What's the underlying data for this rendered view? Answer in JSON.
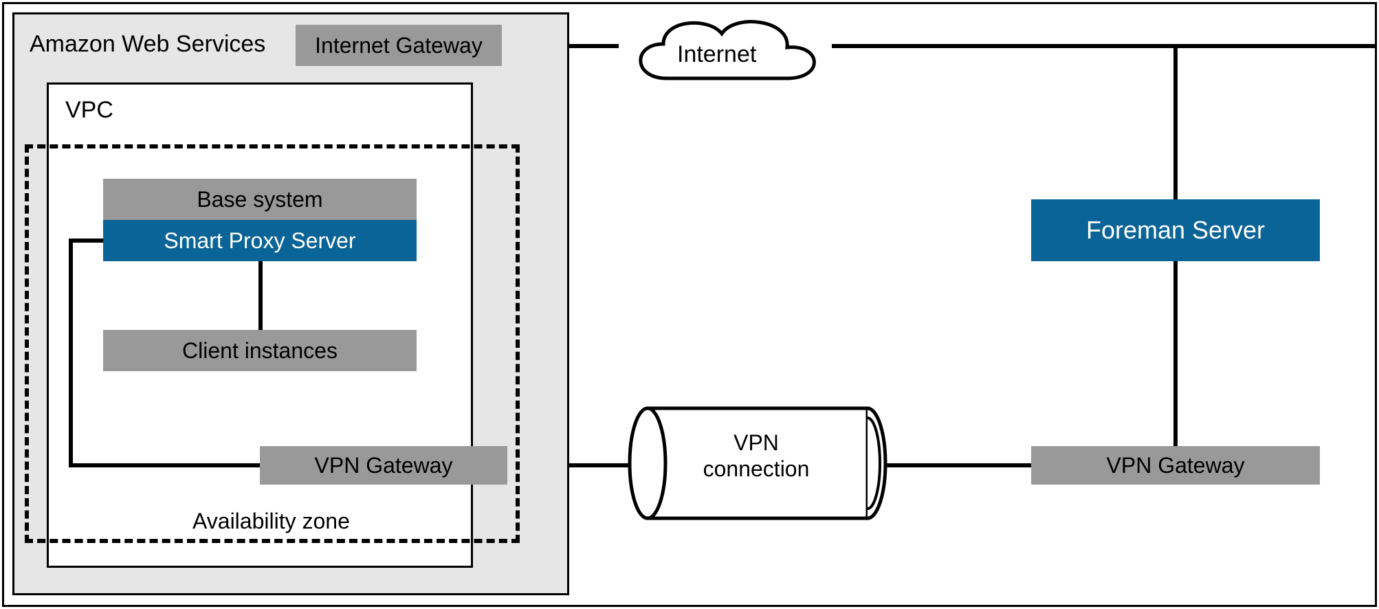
{
  "aws": {
    "title": "Amazon Web Services",
    "internet_gateway_label": "Internet Gateway"
  },
  "vpc": {
    "title": "VPC",
    "availability_zone_label": "Availability zone",
    "base_system_label": "Base system",
    "smart_proxy_label": "Smart Proxy Server",
    "client_instances_label": "Client instances",
    "vpn_gateway_label": "VPN Gateway"
  },
  "internet_label": "Internet",
  "vpn_connection_label": "VPN connection",
  "onprem": {
    "foreman_label": "Foreman Server",
    "vpn_gateway_label": "VPN Gateway"
  }
}
